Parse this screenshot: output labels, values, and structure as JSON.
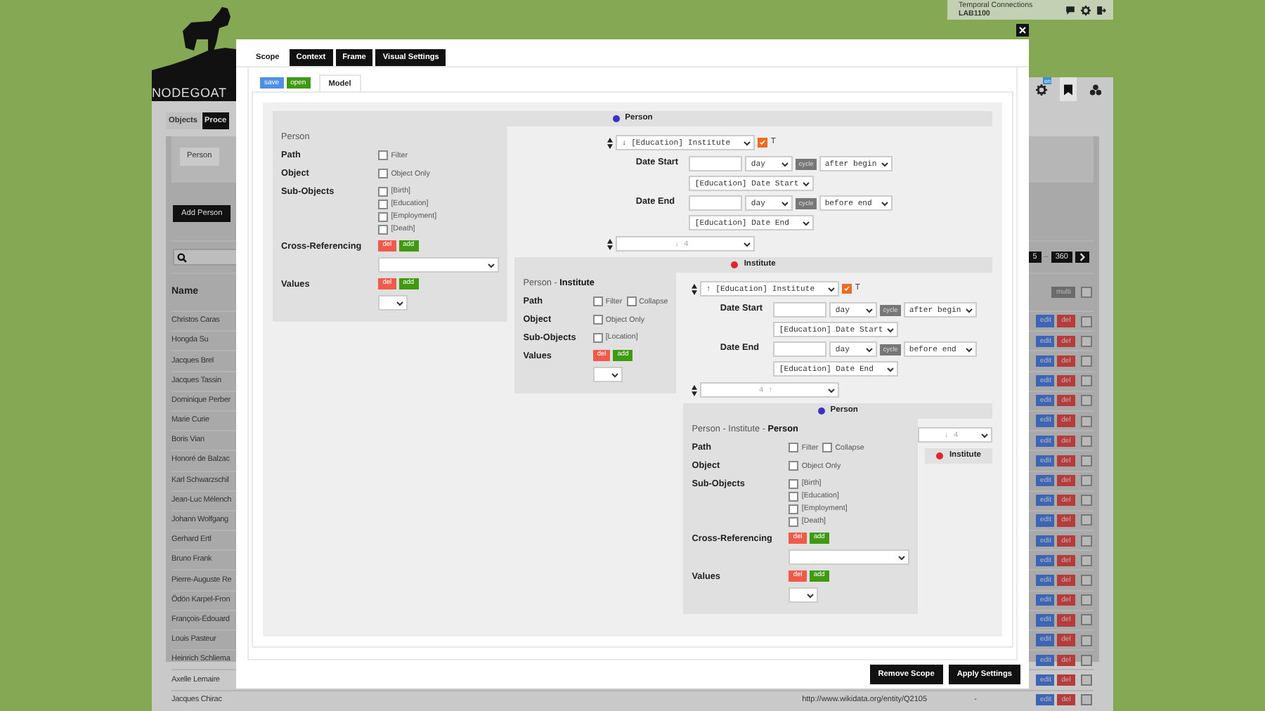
{
  "background_app": {
    "logo": "NODEGOAT",
    "user": {
      "name": "Temporal Connections",
      "lab": "LAB1100"
    },
    "settings_badge": "on",
    "tabs": [
      {
        "label": "Objects",
        "selected": true
      },
      {
        "label": "Proce",
        "selected": false
      }
    ],
    "filter_button": "Person",
    "add_button": "Add Person",
    "pagination": {
      "page": "5",
      "separator": "–",
      "total": "360"
    },
    "table": {
      "columns": [
        "Name"
      ],
      "multi_button": "multi",
      "multi_checked": false,
      "rows": [
        {
          "name": "Christos Caras",
          "actions": [
            "edit",
            "del"
          ],
          "checked": false
        },
        {
          "name": "Hongda Su",
          "actions": [
            "edit",
            "del"
          ],
          "checked": false
        },
        {
          "name": "Jacques Brel",
          "actions": [
            "edit",
            "del"
          ],
          "checked": false
        },
        {
          "name": "Jacques Tassin",
          "actions": [
            "edit",
            "del"
          ],
          "checked": false
        },
        {
          "name": "Dominique Perber",
          "actions": [
            "edit",
            "del"
          ],
          "checked": false
        },
        {
          "name": "Marie Curie",
          "actions": [
            "edit",
            "del"
          ],
          "checked": false
        },
        {
          "name": "Boris Vian",
          "actions": [
            "edit",
            "del"
          ],
          "checked": false
        },
        {
          "name": "Honoré de Balzac",
          "actions": [
            "edit",
            "del"
          ],
          "checked": false
        },
        {
          "name": "Karl Schwarzschil",
          "actions": [
            "edit",
            "del"
          ],
          "checked": false
        },
        {
          "name": "Jean-Luc Mélench",
          "actions": [
            "edit",
            "del"
          ],
          "checked": false
        },
        {
          "name": "Johann Wolfgang",
          "actions": [
            "edit",
            "del"
          ],
          "checked": false
        },
        {
          "name": "Gerhard Ertl",
          "actions": [
            "edit",
            "del"
          ],
          "checked": false
        },
        {
          "name": "Bruno Frank",
          "actions": [
            "edit",
            "del"
          ],
          "checked": false
        },
        {
          "name": "Pierre-Auguste Re",
          "actions": [
            "edit",
            "del"
          ],
          "checked": false
        },
        {
          "name": "Ödön Karpel-Fron",
          "actions": [
            "edit",
            "del"
          ],
          "checked": false
        },
        {
          "name": "François-Édouard",
          "actions": [
            "edit",
            "del"
          ],
          "checked": false
        },
        {
          "name": "Louis Pasteur",
          "actions": [
            "edit",
            "del"
          ],
          "checked": false
        },
        {
          "name": "Heinrich Schliema",
          "actions": [
            "edit",
            "del"
          ],
          "checked": false
        },
        {
          "name": "Axelle Lemaire",
          "actions": [
            "edit",
            "del"
          ],
          "checked": false
        },
        {
          "name": "Jacques Chirac",
          "url": "http://www.wikidata.org/entity/Q2105",
          "column_3": "-",
          "actions": [
            "edit",
            "del"
          ],
          "checked": false
        }
      ]
    }
  },
  "dialog": {
    "tabs": [
      {
        "label": "Scope",
        "selected": true
      },
      {
        "label": "Context",
        "selected": false
      },
      {
        "label": "Frame",
        "selected": false
      },
      {
        "label": "Visual Settings",
        "selected": false
      }
    ],
    "store_buttons": [
      {
        "label": "save",
        "kind": "save"
      },
      {
        "label": "open",
        "kind": "open"
      }
    ],
    "subtabs": [
      {
        "label": "Model",
        "selected": true
      }
    ],
    "model": {
      "title": "Person",
      "color": "#3b2fc4",
      "path": "Person",
      "rows": [
        {
          "label": "Path",
          "kind": "inline",
          "options": [
            {
              "label": "Filter",
              "checked": false
            }
          ]
        },
        {
          "label": "Object",
          "kind": "inline",
          "options": [
            {
              "label": "Object Only",
              "checked": false
            }
          ]
        },
        {
          "label": "Sub-Objects",
          "kind": "stack",
          "options": [
            {
              "label": "[Birth]",
              "checked": false
            },
            {
              "label": "[Education]",
              "checked": false
            },
            {
              "label": "[Employment]",
              "checked": false
            },
            {
              "label": "[Death]",
              "checked": false
            }
          ]
        },
        {
          "label": "Cross-Referencing",
          "kind": "reference",
          "buttons": [
            {
              "label": "del",
              "kind": "remove"
            },
            {
              "label": "add",
              "kind": "add"
            }
          ]
        },
        {
          "label": "Values",
          "kind": "values",
          "buttons": [
            {
              "label": "del",
              "kind": "remove"
            },
            {
              "label": "add",
              "kind": "add"
            }
          ]
        }
      ],
      "connections": [
        {
          "kind": "link",
          "sortable": true,
          "value": "↓ [Education] Institute",
          "timed": true,
          "timed_label": "T",
          "dates": [
            {
              "label": "Date Start",
              "unit": "day",
              "cycle": "cycle",
              "relation": "after begin",
              "source": "[Education] Date Start"
            },
            {
              "label": "Date End",
              "unit": "day",
              "cycle": "cycle",
              "relation": "before end",
              "source": "[Education] Date End"
            }
          ]
        },
        {
          "kind": "empty",
          "sortable": true,
          "value": "↓ 4"
        }
      ],
      "child": {
        "title": "Institute",
        "color": "#e0262c",
        "path": "Person - **Institute**",
        "rows": [
          {
            "label": "Path",
            "kind": "inline",
            "options": [
              {
                "label": "Filter",
                "checked": false
              },
              {
                "label": "Collapse",
                "checked": false
              }
            ]
          },
          {
            "label": "Object",
            "kind": "inline",
            "options": [
              {
                "label": "Object Only",
                "checked": false
              }
            ]
          },
          {
            "label": "Sub-Objects",
            "kind": "stack",
            "options": [
              {
                "label": "[Location]",
                "checked": false
              }
            ]
          },
          {
            "label": "Values",
            "kind": "values",
            "buttons": [
              {
                "label": "del",
                "kind": "remove"
              },
              {
                "label": "add",
                "kind": "add"
              }
            ]
          }
        ],
        "connections": [
          {
            "kind": "link",
            "sortable": true,
            "value": "↑ [Education] Institute",
            "timed": true,
            "timed_label": "T",
            "dates": [
              {
                "label": "Date Start",
                "unit": "day",
                "cycle": "cycle",
                "relation": "after begin",
                "source": "[Education] Date Start"
              },
              {
                "label": "Date End",
                "unit": "day",
                "cycle": "cycle",
                "relation": "before end",
                "source": "[Education] Date End"
              }
            ]
          },
          {
            "kind": "empty",
            "sortable": true,
            "value": "4 ↑"
          }
        ],
        "child": {
          "title": "Person",
          "color": "#3b2fc4",
          "path": "Person - Institute - **Person**",
          "rows": [
            {
              "label": "Path",
              "kind": "inline",
              "options": [
                {
                  "label": "Filter",
                  "checked": false
                },
                {
                  "label": "Collapse",
                  "checked": false
                }
              ]
            },
            {
              "label": "Object",
              "kind": "inline",
              "options": [
                {
                  "label": "Object Only",
                  "checked": false
                }
              ]
            },
            {
              "label": "Sub-Objects",
              "kind": "stack",
              "options": [
                {
                  "label": "[Birth]",
                  "checked": false
                },
                {
                  "label": "[Education]",
                  "checked": false
                },
                {
                  "label": "[Employment]",
                  "checked": false
                },
                {
                  "label": "[Death]",
                  "checked": false
                }
              ]
            },
            {
              "label": "Cross-Referencing",
              "kind": "reference",
              "buttons": [
                {
                  "label": "del",
                  "kind": "remove"
                },
                {
                  "label": "add",
                  "kind": "add"
                }
              ]
            },
            {
              "label": "Values",
              "kind": "values",
              "buttons": [
                {
                  "label": "del",
                  "kind": "remove"
                },
                {
                  "label": "add",
                  "kind": "add"
                }
              ]
            }
          ],
          "connections": [
            {
              "kind": "empty",
              "sortable": false,
              "value": "↓ 4"
            }
          ],
          "child": {
            "title": "Institute",
            "color": "#e0262c"
          }
        }
      }
    },
    "footer_buttons": [
      "Remove Scope",
      "Apply Settings"
    ]
  }
}
